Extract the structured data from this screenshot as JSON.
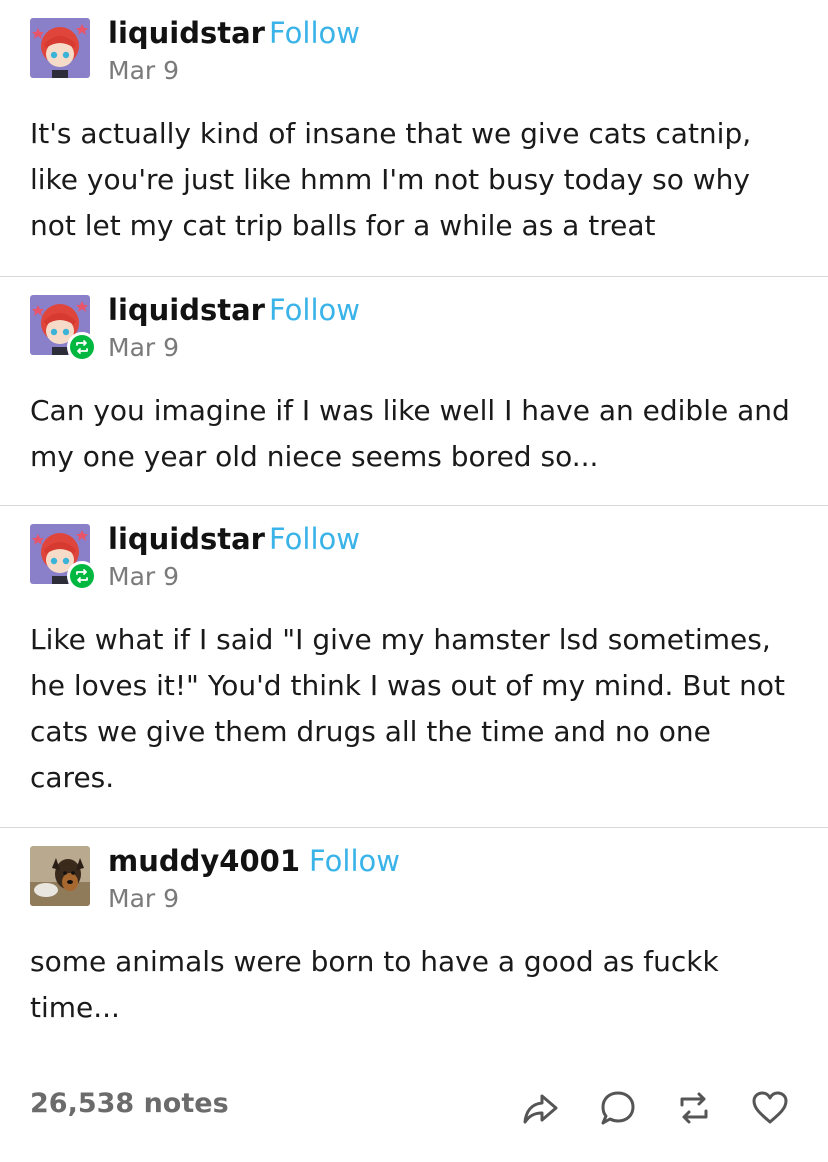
{
  "posts": [
    {
      "username": "liquidstar",
      "follow_label": "Follow",
      "date": "Mar 9",
      "text": "It's actually kind of insane that we give cats catnip, like you're just like hmm I'm not busy today so why not let my cat trip balls for a while as a treat"
    },
    {
      "username": "liquidstar",
      "follow_label": "Follow",
      "date": "Mar 9",
      "text": "Can you imagine if I was like well I have an edible and my one year old niece seems bored so..."
    },
    {
      "username": "liquidstar",
      "follow_label": "Follow",
      "date": "Mar 9",
      "text": "Like what if I said \"I give my hamster lsd sometimes, he loves it!\" You'd think I was out of my mind. But not cats we give them drugs all the time and no one cares."
    },
    {
      "username": "muddy4001",
      "follow_label": "Follow",
      "date": "Mar 9",
      "text": "some animals were born to have a good as fuckk time..."
    }
  ],
  "footer": {
    "notes": "26,538 notes",
    "icons": [
      "share-icon",
      "reply-icon",
      "reblog-icon",
      "like-icon"
    ]
  },
  "colors": {
    "follow": "#39b3e8",
    "reblog_badge": "#00b83f",
    "divider": "#d8d8d8",
    "notes": "#6b6b6b"
  }
}
